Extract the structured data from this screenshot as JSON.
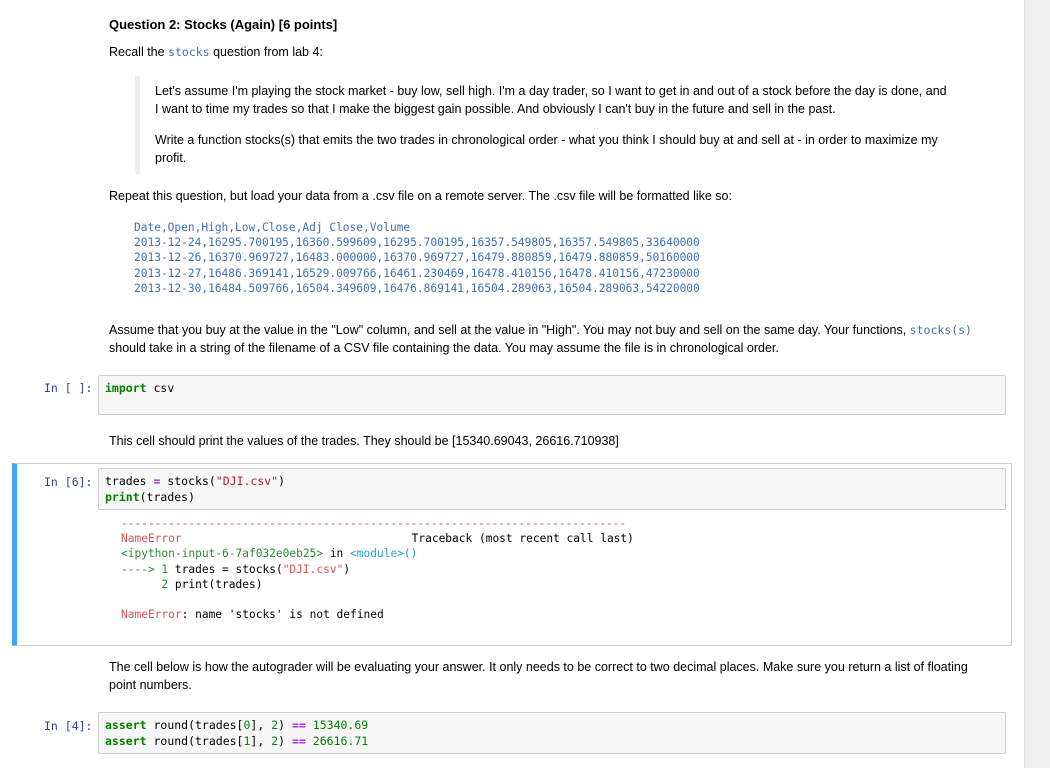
{
  "question": {
    "title": "Question 2: Stocks (Again) [6 points]",
    "recall_prefix": "Recall the",
    "recall_code": "stocks",
    "recall_suffix": "question from lab 4:"
  },
  "blockquote": {
    "p1_line1": "Let's assume I'm playing the stock market - buy low, sell high. I'm a day trader, so I want to get in and out of a stock before the day is done, and",
    "p1_line2": "I want to time my trades so that I make the biggest gain possible. And obviously I can't buy in the future and sell in the past.",
    "p2_line1": "Write a function stocks(s) that emits the two trades in chronological order - what you think I should buy at and sell at - in order to maximize my",
    "p2_line2": "profit."
  },
  "repeat_text": "Repeat this question, but load your data from a .csv file on a remote server. The .csv file will be formatted like so:",
  "csv_lines": [
    "Date,Open,High,Low,Close,Adj Close,Volume",
    "2013-12-24,16295.700195,16360.599609,16295.700195,16357.549805,16357.549805,33640000",
    "2013-12-26,16370.969727,16483.000000,16370.969727,16479.880859,16479.880859,50160000",
    "2013-12-27,16486.369141,16529.009766,16461.230469,16478.410156,16478.410156,47230000",
    "2013-12-30,16484.509766,16504.349609,16476.869141,16504.289063,16504.289063,54220000"
  ],
  "assume": {
    "line1_text": "Assume that you buy at the value in the \"Low\" column, and sell at the value in \"High\". You may not buy and sell on the same day. Your functions,",
    "line1_code": "stocks(s)",
    "line2_text": "should take in a string of the filename of a CSV file containing the data. You may assume the file is in chronological order."
  },
  "cell1": {
    "prompt": "In [ ]:",
    "kw": "import",
    "rest": " csv"
  },
  "print_text": "This cell should print the values of the trades. They should be [15340.69043, 26616.710938]",
  "cell2": {
    "prompt": "In [6]:",
    "line1_a": "trades ",
    "line1_op": "=",
    "line1_b": " stocks(",
    "line1_str": "\"DJI.csv\"",
    "line1_c": ")",
    "line2_kw": "print",
    "line2_rest": "(trades)"
  },
  "traceback": {
    "dashes": "---------------------------------------------------------------------------",
    "error_name": "NameError",
    "header_right": "Traceback (most recent call last)",
    "input_ref_a": "<ipython-input-6-7af032e0eb25>",
    "input_ref_in": " in ",
    "input_ref_b": "<module>()",
    "arrow": "---->",
    "line1_num": " 1",
    "line1_code": " trades = stocks(",
    "line1_str": "\"DJI.csv\"",
    "line1_close": ")",
    "line2_num": "      2",
    "line2_code": " print(trades)",
    "final_name": "NameError",
    "final_msg": ": name 'stocks' is not defined"
  },
  "autograder": {
    "line1": "The cell below is how the autograder will be evaluating your answer. It only needs to be correct to two decimal places. Make sure you return a list of floating",
    "line2": "point numbers."
  },
  "cell3": {
    "prompt": "In [4]:",
    "l1_kw": "assert",
    "l1_a": " round(trades[",
    "l1_idx": "0",
    "l1_b": "], ",
    "l1_dec": "2",
    "l1_c": ") ",
    "l1_op": "==",
    "l1_val": "15340.69",
    "l2_kw": "assert",
    "l2_a": " round(trades[",
    "l2_idx": "1",
    "l2_b": "], ",
    "l2_dec": "2",
    "l2_c": ") ",
    "l2_op": "==",
    "l2_val": "26616.71"
  }
}
